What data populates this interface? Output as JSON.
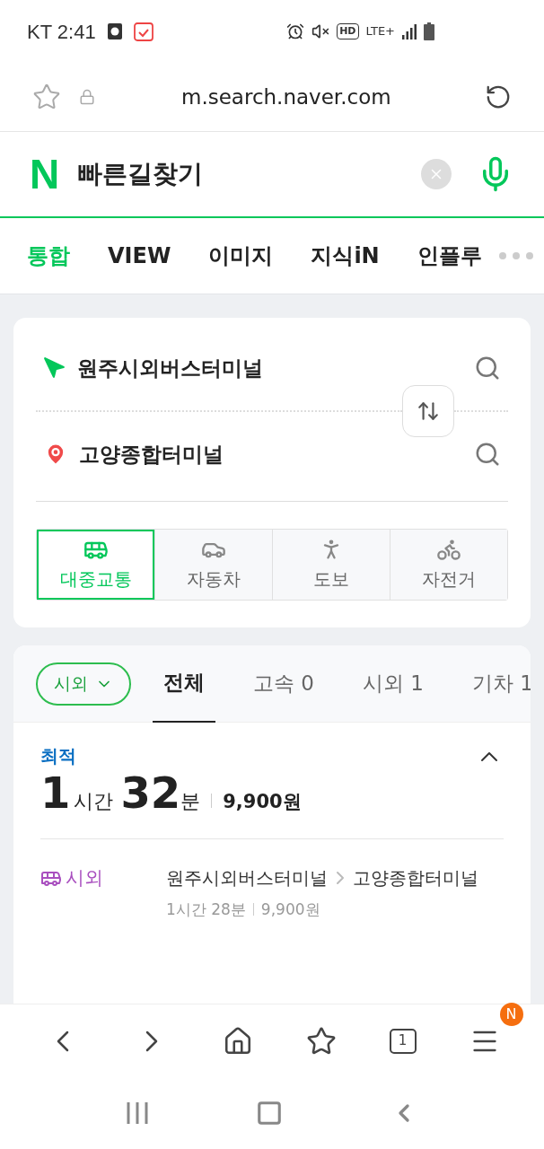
{
  "status_bar": {
    "carrier_time": "KT 2:41",
    "hd": "HD",
    "network": "LTE+"
  },
  "url_bar": {
    "url": "m.search.naver.com"
  },
  "search": {
    "logo": "N",
    "query": "빠른길찾기"
  },
  "tabs": [
    {
      "label": "통합",
      "selected": true
    },
    {
      "label": "VIEW",
      "selected": false
    },
    {
      "label": "이미지",
      "selected": false
    },
    {
      "label": "지식iN",
      "selected": false
    },
    {
      "label": "인플루",
      "selected": false
    }
  ],
  "route": {
    "origin": "원주시외버스터미널",
    "destination": "고양종합터미널",
    "modes": [
      {
        "kind": "transit",
        "label": "대중교통",
        "selected": true
      },
      {
        "kind": "car",
        "label": "자동차",
        "selected": false
      },
      {
        "kind": "walk",
        "label": "도보",
        "selected": false
      },
      {
        "kind": "bike",
        "label": "자전거",
        "selected": false
      }
    ]
  },
  "results": {
    "filter": "시외",
    "subtabs": [
      {
        "label": "전체",
        "selected": true
      },
      {
        "label": "고속 0",
        "selected": false
      },
      {
        "label": "시외 1",
        "selected": false
      },
      {
        "label": "기차 1",
        "selected": false
      }
    ],
    "best": {
      "label": "최적",
      "expanded": true,
      "hours": "1",
      "hours_unit": "시간",
      "minutes": "32",
      "minutes_unit": "분",
      "price": "9,900원",
      "segments": [
        {
          "kind": "bus",
          "label": "시외",
          "color": "#a94fbf",
          "from": "원주시외버스터미널",
          "to": "고양종합터미널",
          "duration": "1시간 28분",
          "price": "9,900원"
        }
      ]
    }
  },
  "bottom_bar": {
    "tab_count": "1",
    "menu_badge": "N"
  }
}
